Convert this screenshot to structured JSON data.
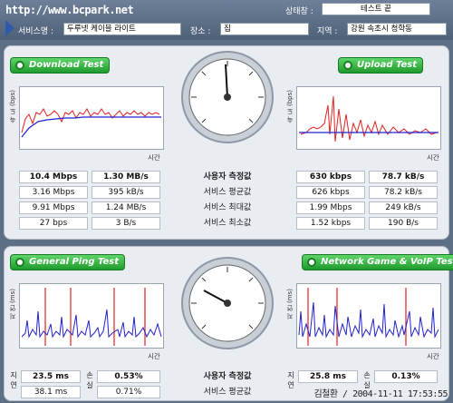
{
  "header": {
    "watermark": "http://www.bcpark.net",
    "status_label": "상태창 :",
    "status_value": "테스트 끝",
    "service_label": "서비스명 :",
    "service_value": "두루넷 케이블 라이트",
    "place_label": "장소 :",
    "place_value": "집",
    "region_label": "지역 :",
    "region_value": "강원 속초시 청학동"
  },
  "download_btn": "Download Test",
  "upload_btn": "Upload Test",
  "ping_btn": "General Ping Test",
  "game_btn": "Network Game & VoIP Test",
  "speed_axis_label": "속 도 (bps)",
  "time_label": "시간",
  "latency_axis_label": "지 연 (ms)",
  "center_labels": [
    "사용자 측정값",
    "서비스 평균값",
    "서비스 최대값",
    "서비스 최소값"
  ],
  "download_rows": [
    {
      "bps": "10.4 Mbps",
      "bytes": "1.30 MB/s"
    },
    {
      "bps": "3.16 Mbps",
      "bytes": "395 kB/s"
    },
    {
      "bps": "9.91 Mbps",
      "bytes": "1.24 MB/s"
    },
    {
      "bps": "27 bps",
      "bytes": "3 B/s"
    }
  ],
  "upload_rows": [
    {
      "bps": "630 kbps",
      "bytes": "78.7 kB/s"
    },
    {
      "bps": "626 kbps",
      "bytes": "78.2 kB/s"
    },
    {
      "bps": "1.99 Mbps",
      "bytes": "249 kB/s"
    },
    {
      "bps": "1.52 kbps",
      "bytes": "190 B/s"
    }
  ],
  "ping_labels": {
    "latency": "지연",
    "loss": "손실"
  },
  "ping_rows": [
    {
      "latency": "23.5 ms",
      "loss": "0.53%"
    },
    {
      "latency": "38.1 ms",
      "loss": "0.71%"
    }
  ],
  "game_rows": [
    {
      "latency": "25.8 ms",
      "loss": "0.13%"
    }
  ],
  "bottom_center_labels": [
    "사용자 측정값",
    "서비스 평균값"
  ],
  "stamp": "김철환 / 2004-11-11 17:53:55",
  "colors": {
    "bg": "#5d6f85",
    "panel": "#e9edf2",
    "green": "#1f9a2c",
    "red": "#e02020",
    "blue": "#2020d0"
  }
}
